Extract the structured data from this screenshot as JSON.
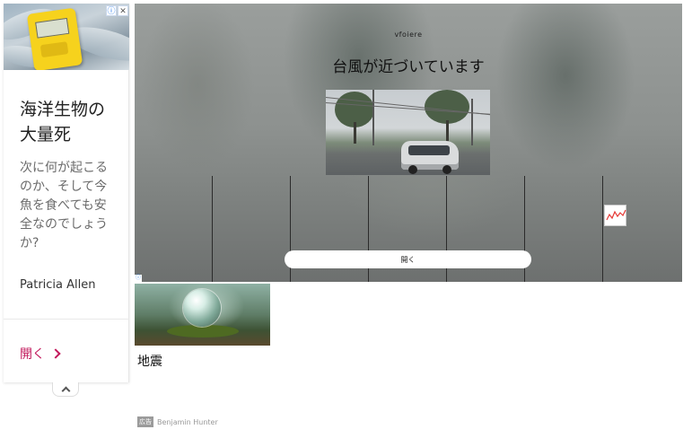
{
  "side_ad": {
    "title": "海洋生物の大量死",
    "body": "次に何が起こるのか、そして今魚を食べても安全なのでしょうか?",
    "author": "Patricia Allen",
    "cta_label": "開く",
    "ad_info_glyph": "ⓘ",
    "close_glyph": "✕"
  },
  "banner": {
    "brand": "vfoiere",
    "headline": "台風が近づいています",
    "open_label": "開く",
    "ad_info_glyph": "ⓘ"
  },
  "card": {
    "title": "地震"
  },
  "sponsor": {
    "badge": "広告",
    "name": "Benjamin Hunter"
  },
  "colors": {
    "cta": "#c2185b",
    "chart_line": "#e53935"
  }
}
